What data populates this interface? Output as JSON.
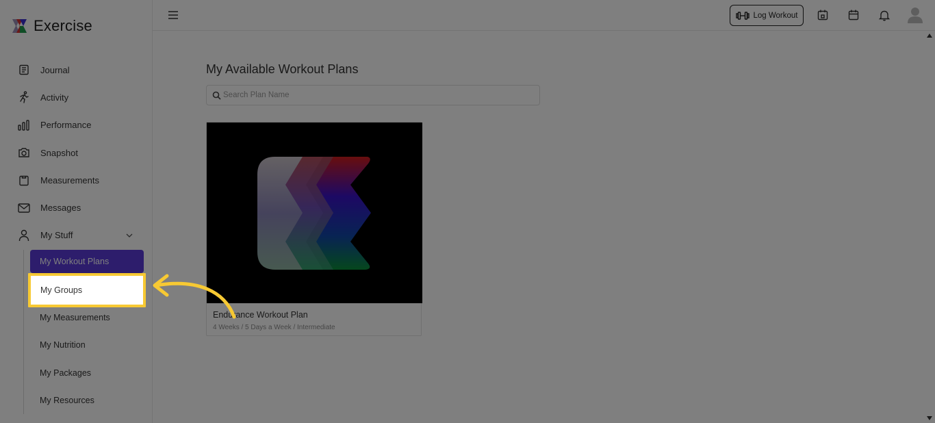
{
  "brand": {
    "name": "Exercise",
    "logo_icon": "exercise-logo-icon"
  },
  "sidebar": {
    "items": [
      {
        "label": "Journal",
        "icon": "journal-icon"
      },
      {
        "label": "Activity",
        "icon": "running-person-icon"
      },
      {
        "label": "Performance",
        "icon": "bar-chart-icon"
      },
      {
        "label": "Snapshot",
        "icon": "camera-icon"
      },
      {
        "label": "Measurements",
        "icon": "clipboard-icon"
      },
      {
        "label": "Messages",
        "icon": "envelope-icon"
      },
      {
        "label": "My Stuff",
        "icon": "user-icon",
        "expanded": true
      }
    ],
    "sub_items": [
      {
        "label": "My Workout Plans",
        "active": true
      },
      {
        "label": "My Groups",
        "highlighted": true
      },
      {
        "label": "My Measurements"
      },
      {
        "label": "My Nutrition"
      },
      {
        "label": "My Packages"
      },
      {
        "label": "My Resources"
      }
    ]
  },
  "topbar": {
    "log_workout_label": "Log Workout",
    "icons": [
      "menu-icon",
      "dumbbell-icon",
      "calendar-day-icon",
      "calendar-icon",
      "bell-icon",
      "avatar-icon"
    ]
  },
  "main": {
    "title": "My Available Workout Plans",
    "search_placeholder": "Search Plan Name",
    "plans": [
      {
        "title": "Endurance Workout Plan",
        "meta": "4 Weeks / 5 Days a Week / Intermediate"
      }
    ]
  },
  "colors": {
    "accent": "#5a3bd8",
    "highlight": "#f7c933",
    "overlay": "rgba(0,0,0,0.5)"
  }
}
